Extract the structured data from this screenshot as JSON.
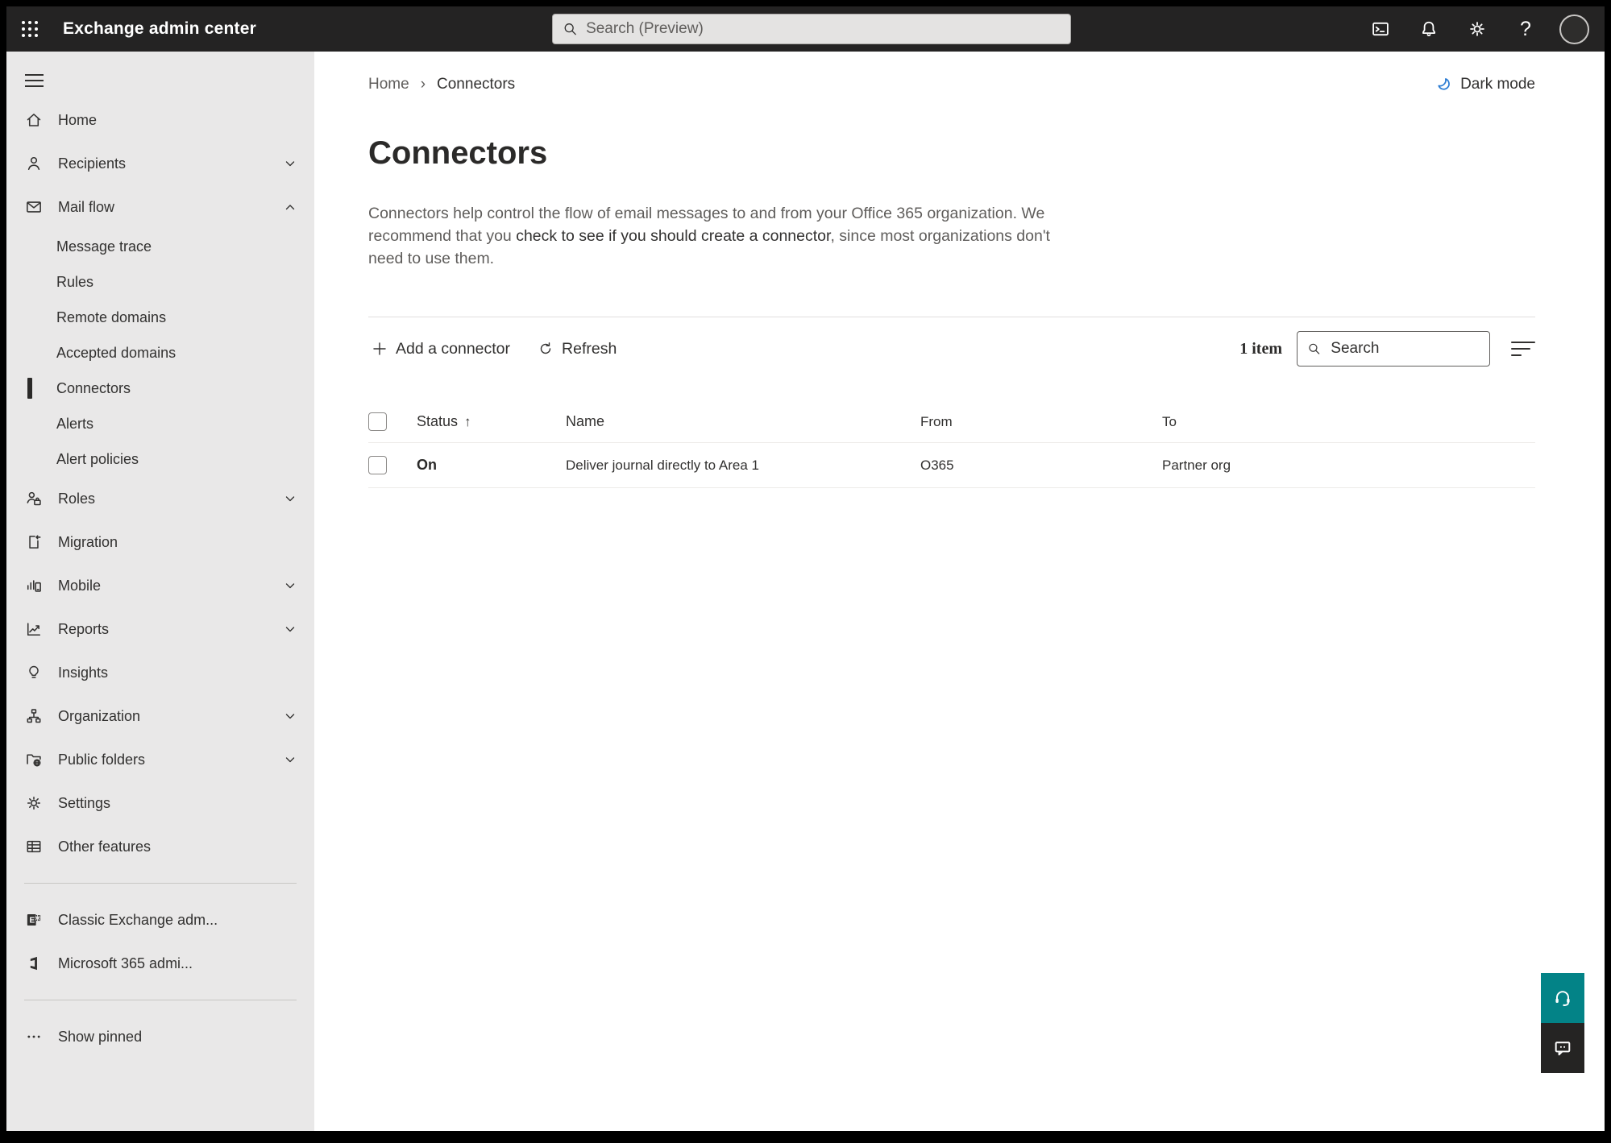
{
  "topbar": {
    "title": "Exchange admin center",
    "search_placeholder": "Search (Preview)"
  },
  "breadcrumb": {
    "home": "Home",
    "separator": "›",
    "current": "Connectors"
  },
  "theme_toggle": {
    "label": "Dark mode"
  },
  "page": {
    "title": "Connectors",
    "desc_part1": "Connectors help control the flow of email messages to and from your Office 365 organization. We recommend that you ",
    "desc_emphasis": "check to see if you should create a connector",
    "desc_part2": ", since most organizations don't need to use them."
  },
  "toolbar": {
    "add_label": "Add a connector",
    "refresh_label": "Refresh",
    "item_count": "1 item",
    "search_placeholder": "Search"
  },
  "table": {
    "headers": {
      "status": "Status",
      "sort_indicator": "↑",
      "name": "Name",
      "from": "From",
      "to": "To"
    },
    "rows": [
      {
        "status": "On",
        "name": "Deliver journal directly to Area 1",
        "from": "O365",
        "to": "Partner org"
      }
    ]
  },
  "sidebar": {
    "items": [
      {
        "label": "Home"
      },
      {
        "label": "Recipients"
      },
      {
        "label": "Mail flow"
      },
      {
        "label": "Message trace"
      },
      {
        "label": "Rules"
      },
      {
        "label": "Remote domains"
      },
      {
        "label": "Accepted domains"
      },
      {
        "label": "Connectors"
      },
      {
        "label": "Alerts"
      },
      {
        "label": "Alert policies"
      },
      {
        "label": "Roles"
      },
      {
        "label": "Migration"
      },
      {
        "label": "Mobile"
      },
      {
        "label": "Reports"
      },
      {
        "label": "Insights"
      },
      {
        "label": "Organization"
      },
      {
        "label": "Public folders"
      },
      {
        "label": "Settings"
      },
      {
        "label": "Other features"
      },
      {
        "label": "Classic Exchange adm..."
      },
      {
        "label": "Microsoft 365 admi..."
      },
      {
        "label": "Show pinned"
      }
    ]
  },
  "colors": {
    "topbar_bg": "#242323",
    "sidebar_bg": "#e9e8e8",
    "accent_teal": "#038387",
    "moon_blue": "#2b7cd3",
    "text_primary": "#323130",
    "text_secondary": "#605e5c",
    "selected_indicator": "#2b2a29"
  }
}
